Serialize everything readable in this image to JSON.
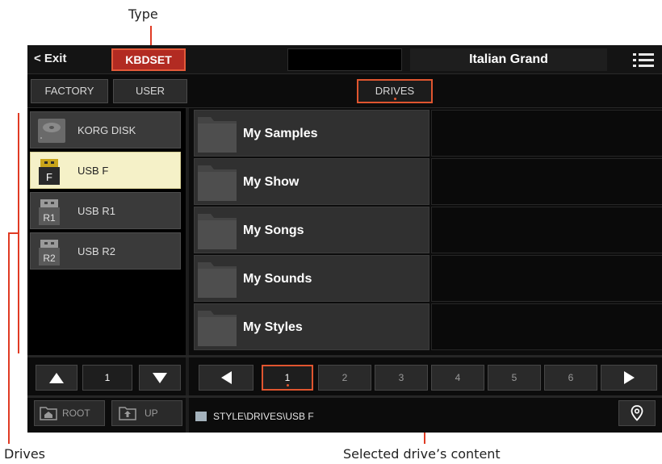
{
  "annotations": {
    "type": "Type",
    "drives": "Drives",
    "content": "Selected drive’s content"
  },
  "topbar": {
    "exit": "< Exit",
    "mode": "KBDSET",
    "sound": "Italian Grand",
    "menu_icon": "hamburger-menu-icon"
  },
  "tabs": {
    "factory": "FACTORY",
    "user": "USER",
    "drives": "DRIVES"
  },
  "drives": [
    {
      "label": "KORG DISK",
      "icon": "disk-icon",
      "selected": false
    },
    {
      "label": "USB F",
      "icon_text": "F",
      "icon": "usb-drive-icon",
      "selected": true
    },
    {
      "label": "USB R1",
      "icon_text": "R1",
      "icon": "usb-drive-icon",
      "selected": false
    },
    {
      "label": "USB R2",
      "icon_text": "R2",
      "icon": "usb-drive-icon",
      "selected": false
    }
  ],
  "folders": [
    "My Samples",
    "My Show",
    "My Songs",
    "My Sounds",
    "My Styles"
  ],
  "drive_scroll": {
    "page": "1"
  },
  "pages": {
    "items": [
      "1",
      "2",
      "3",
      "4",
      "5",
      "6"
    ],
    "selected": "1"
  },
  "nav": {
    "root": "ROOT",
    "up": "UP"
  },
  "path": "STYLE\\DRIVES\\USB F",
  "colors": {
    "accent": "#e0552f",
    "kbdset_bg": "#b22b22",
    "selected_drive_bg": "#f5f1c8",
    "annotation_line": "#e03b24"
  }
}
